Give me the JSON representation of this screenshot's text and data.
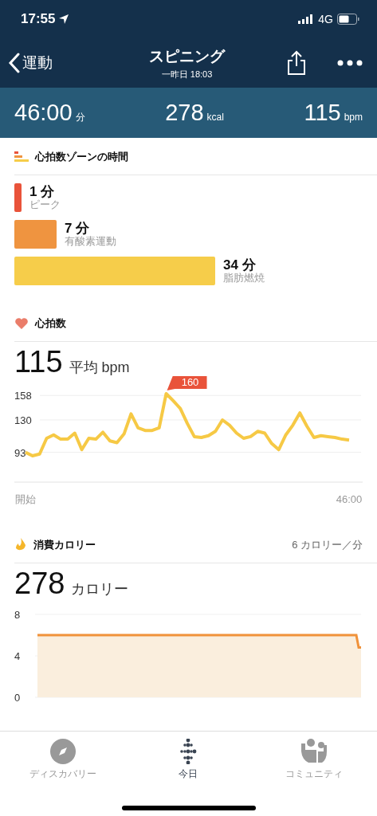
{
  "status_bar": {
    "time": "17:55",
    "network": "4G"
  },
  "nav": {
    "back": "運動",
    "title": "スピニング",
    "subtitle": "一昨日 18:03"
  },
  "stats": [
    {
      "value": "46:00",
      "unit": "分"
    },
    {
      "value": "278",
      "unit": "kcal"
    },
    {
      "value": "115",
      "unit": "bpm"
    }
  ],
  "zones": {
    "title": "心拍数ゾーンの時間",
    "items": [
      {
        "minutes": "1 分",
        "name": "ピーク",
        "color": "#e9533a"
      },
      {
        "minutes": "7 分",
        "name": "有酸素運動",
        "color": "#ef9440"
      },
      {
        "minutes": "34 分",
        "name": "脂肪燃焼",
        "color": "#f6cd4a"
      }
    ]
  },
  "heart_rate": {
    "title": "心拍数",
    "value": "115",
    "unit": "平均 bpm",
    "chart_data": {
      "type": "line",
      "categories": [
        "開始",
        null,
        null,
        null,
        null,
        null,
        null,
        null,
        null,
        null,
        null,
        null,
        null,
        null,
        null,
        null,
        null,
        null,
        null,
        null,
        null,
        null,
        null,
        null,
        null,
        null,
        null,
        null,
        null,
        null,
        null,
        null,
        null,
        null,
        null,
        null,
        null,
        null,
        null,
        null,
        null,
        null,
        null,
        null,
        null,
        null,
        "46:00"
      ],
      "series": [
        {
          "color": "#f6c945",
          "values": [
            93,
            89,
            91,
            109,
            113,
            108,
            108,
            115,
            96,
            109,
            108,
            116,
            106,
            104,
            114,
            137,
            121,
            118,
            118,
            121,
            160,
            152,
            143,
            126,
            111,
            110,
            112,
            117,
            130,
            124,
            115,
            109,
            111,
            117,
            115,
            103,
            96,
            113,
            124,
            138,
            123,
            110,
            112,
            111,
            110,
            108,
            107
          ]
        }
      ],
      "ylim": [
        59,
        160
      ],
      "yticks": [
        93,
        130,
        158
      ],
      "grid": true,
      "annotations": [
        "160"
      ]
    }
  },
  "calories": {
    "title": "消費カロリー",
    "rate": "6 カロリー／分",
    "value": "278",
    "unit": "カロリー",
    "chart_data": {
      "type": "area",
      "series": [
        {
          "color": "#faeedd",
          "values": [
            6,
            6,
            6,
            6,
            6,
            6,
            6,
            6,
            6,
            6,
            6,
            6,
            6,
            6,
            6,
            6,
            6,
            6,
            6,
            6,
            6,
            6,
            6,
            6,
            6,
            6,
            6,
            6,
            6,
            6,
            6,
            6,
            6,
            6,
            6,
            6,
            6,
            6,
            6,
            6,
            6,
            6,
            6,
            6,
            6,
            6,
            6,
            6,
            6,
            6,
            6,
            6,
            6,
            6,
            6,
            6,
            6,
            6,
            6,
            6,
            6,
            6,
            6,
            6,
            6,
            6,
            6,
            6,
            6,
            6,
            6,
            6,
            6,
            6,
            6,
            6,
            6,
            6,
            6,
            6,
            6,
            6,
            6,
            6,
            6,
            6,
            6,
            6,
            6,
            6,
            6,
            6,
            6,
            6,
            6,
            6,
            6,
            6,
            6,
            6,
            6,
            6,
            6,
            6,
            6,
            6,
            6,
            6,
            6,
            6,
            6,
            6,
            6,
            6,
            6,
            6,
            6,
            6,
            6,
            6,
            6,
            6,
            6,
            6,
            6,
            6,
            6,
            6,
            6,
            6,
            6,
            6,
            6,
            6,
            6,
            4.8,
            4.8
          ]
        }
      ],
      "ylim": [
        0,
        8
      ],
      "yticks": [
        0,
        4,
        8
      ]
    }
  },
  "tab_bar": [
    {
      "label": "ディスカバリー",
      "selected": false
    },
    {
      "label": "今日",
      "selected": true
    },
    {
      "label": "コミュニティ",
      "selected": false
    }
  ]
}
